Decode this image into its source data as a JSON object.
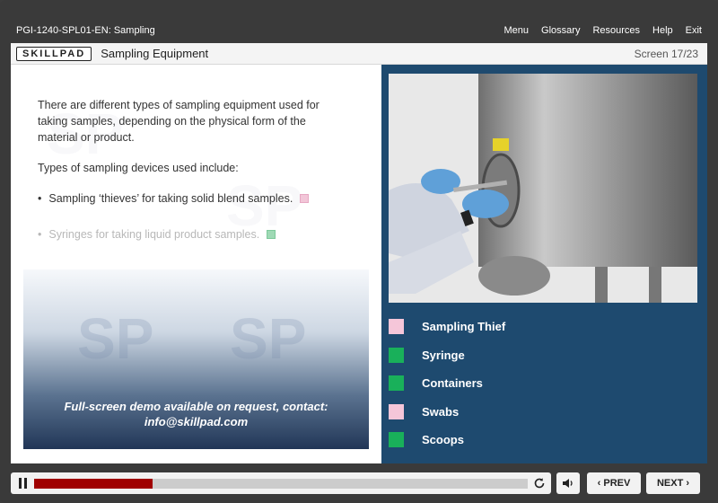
{
  "top_bar": {
    "course_title": "PGI-1240-SPL01-EN: Sampling",
    "menu_items": [
      "Menu",
      "Glossary",
      "Resources",
      "Help",
      "Exit"
    ]
  },
  "header": {
    "logo": "SKILLPAD",
    "title": "Sampling Equipment",
    "screen_counter": "Screen 17/23"
  },
  "body_text": {
    "intro": "There are different types of sampling equipment used for taking samples, depending on the physical form of the material or product.",
    "types_heading": "Types of sampling devices used include:",
    "bullets": [
      "Sampling ‘thieves’ for taking solid blend samples.",
      "Syringes for taking liquid product samples."
    ]
  },
  "demo_banner": {
    "line1": "Full-screen demo available on request, contact:",
    "line2": "info@skillpad.com"
  },
  "equipment_list": [
    {
      "label": "Sampling Thief",
      "state": "visited-pink"
    },
    {
      "label": "Syringe",
      "state": "unvisited-green"
    },
    {
      "label": "Containers",
      "state": "unvisited-green"
    },
    {
      "label": "Swabs",
      "state": "visited-pink"
    },
    {
      "label": "Scoops",
      "state": "unvisited-green"
    }
  ],
  "controls": {
    "prev_label": "PREV",
    "next_label": "NEXT",
    "progress_fraction": 0.24
  },
  "colors": {
    "panel_blue": "#1e4a6f",
    "pink": "#f5c6d9",
    "green": "#19b05a",
    "progress_red": "#a00000"
  }
}
